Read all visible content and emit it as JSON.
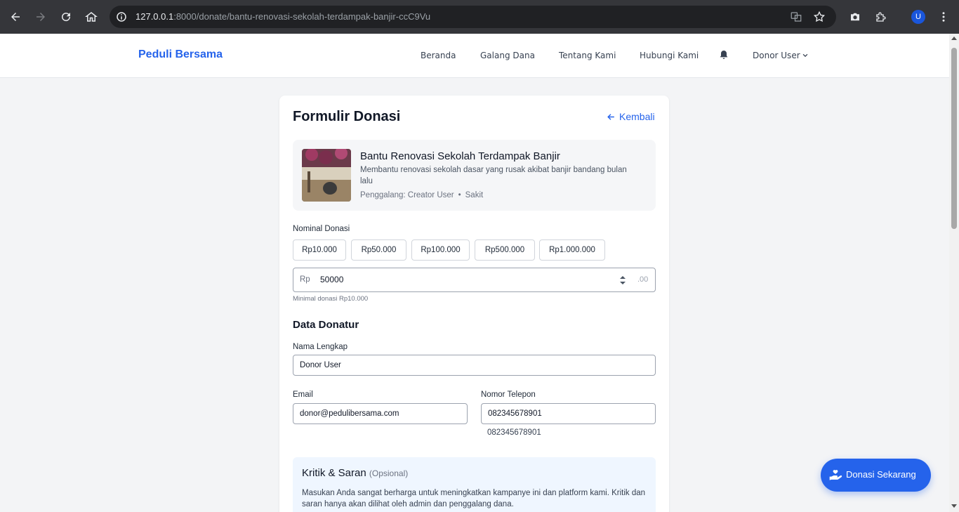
{
  "browser": {
    "url_host": "127.0.0.1",
    "url_path": ":8000/donate/bantu-renovasi-sekolah-terdampak-banjir-ccC9Vu",
    "profile_initial": "U"
  },
  "nav": {
    "brand": "Peduli Bersama",
    "links": [
      "Beranda",
      "Galang Dana",
      "Tentang Kami",
      "Hubungi Kami"
    ],
    "user": "Donor User"
  },
  "form": {
    "title": "Formulir Donasi",
    "back_label": "Kembali"
  },
  "campaign": {
    "title": "Bantu Renovasi Sekolah Terdampak Banjir",
    "description": "Membantu renovasi sekolah dasar yang rusak akibat banjir bandang bulan lalu",
    "creator": "Penggalang: Creator User",
    "separator": "•",
    "category": "Sakit"
  },
  "amount": {
    "label": "Nominal Donasi",
    "presets": [
      "Rp10.000",
      "Rp50.000",
      "Rp100.000",
      "Rp500.000",
      "Rp1.000.000"
    ],
    "prefix": "Rp",
    "value": "50000",
    "suffix": ".00",
    "hint": "Minimal donasi Rp10.000"
  },
  "donor": {
    "section_title": "Data Donatur",
    "name_label": "Nama Lengkap",
    "name_value": "Donor User",
    "email_label": "Email",
    "email_value": "donor@pedulibersama.com",
    "phone_label": "Nomor Telepon",
    "phone_value": "082345678901",
    "phone_echo": "082345678901"
  },
  "feedback": {
    "title": "Kritik & Saran",
    "optional": "(Opsional)",
    "description": "Masukan Anda sangat berharga untuk meningkatkan kampanye ini dan platform kami. Kritik dan saran hanya akan dilihat oleh admin dan penggalang dana."
  },
  "fab": {
    "label": "Donasi Sekarang"
  },
  "colors": {
    "accent": "#2563eb",
    "page_bg": "#f3f4f6",
    "feedback_bg": "#eff6ff"
  }
}
